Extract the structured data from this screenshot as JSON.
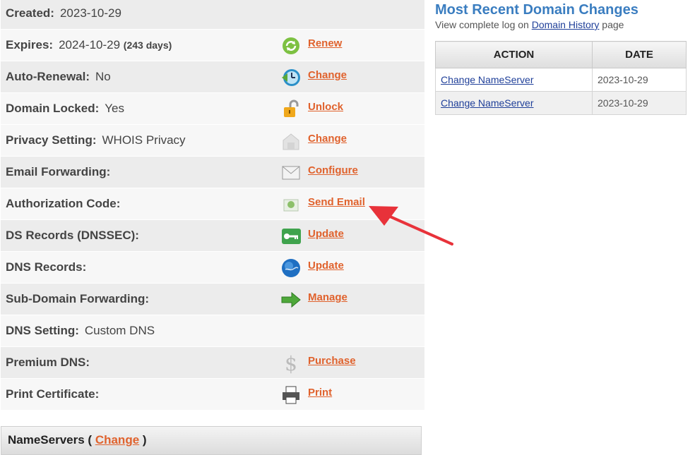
{
  "details": {
    "rows": [
      {
        "label": "Created:",
        "value": "2023-10-29",
        "extra": "",
        "action": "",
        "icon": ""
      },
      {
        "label": "Expires:",
        "value": "2024-10-29",
        "extra": "(243 days)",
        "action": "Renew",
        "icon": "renew-icon"
      },
      {
        "label": "Auto-Renewal:",
        "value": "No",
        "extra": "",
        "action": "Change",
        "icon": "clock-icon"
      },
      {
        "label": "Domain Locked:",
        "value": "Yes",
        "extra": "",
        "action": "Unlock",
        "icon": "padlock-icon"
      },
      {
        "label": "Privacy Setting:",
        "value": "WHOIS Privacy",
        "extra": "",
        "action": "Change",
        "icon": "privacy-house-icon"
      },
      {
        "label": "Email Forwarding:",
        "value": "",
        "extra": "",
        "action": "Configure",
        "icon": "envelope-icon"
      },
      {
        "label": "Authorization Code:",
        "value": "",
        "extra": "",
        "action": "Send Email",
        "icon": "mail-send-icon"
      },
      {
        "label": "DS Records (DNSSEC):",
        "value": "",
        "extra": "",
        "action": "Update",
        "icon": "key-icon"
      },
      {
        "label": "DNS Records:",
        "value": "",
        "extra": "",
        "action": "Update",
        "icon": "globe-icon"
      },
      {
        "label": "Sub-Domain Forwarding:",
        "value": "",
        "extra": "",
        "action": "Manage",
        "icon": "arrow-right-icon"
      },
      {
        "label": "DNS Setting:",
        "value": "Custom DNS",
        "extra": "",
        "action": "",
        "icon": ""
      },
      {
        "label": "Premium DNS:",
        "value": "",
        "extra": "",
        "action": "Purchase",
        "icon": "dollar-icon"
      },
      {
        "label": "Print Certificate:",
        "value": "",
        "extra": "",
        "action": "Print",
        "icon": "printer-icon"
      }
    ]
  },
  "nameservers": {
    "title": "NameServers (",
    "change_label": "Change",
    "close": ")"
  },
  "recent": {
    "title": "Most Recent Domain Changes",
    "sub_prefix": "View complete log on ",
    "sub_link": "Domain History",
    "sub_suffix": " page",
    "headers": {
      "action": "ACTION",
      "date": "DATE"
    },
    "rows": [
      {
        "action": "Change NameServer",
        "date": "2023-10-29"
      },
      {
        "action": "Change NameServer",
        "date": "2023-10-29"
      }
    ]
  },
  "colors": {
    "action_link": "#e0622d",
    "title_blue": "#3a7dc0",
    "annotation_arrow": "#e8323a"
  }
}
